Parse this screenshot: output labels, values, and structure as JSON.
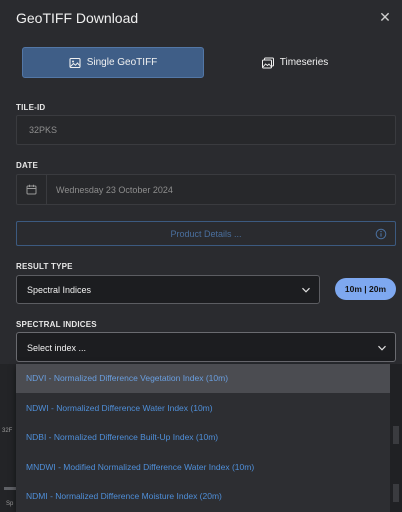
{
  "dialog": {
    "title": "GeoTIFF Download",
    "close_icon": "close-icon"
  },
  "tabs": [
    {
      "label": "Single GeoTIFF",
      "icon": "image-icon",
      "active": true
    },
    {
      "label": "Timeseries",
      "icon": "images-icon",
      "active": false
    }
  ],
  "tile_id": {
    "label": "TILE-ID",
    "value": "32PKS"
  },
  "date": {
    "label": "DATE",
    "icon": "calendar-icon",
    "value": "Wednesday 23 October 2024"
  },
  "product_details": {
    "label": "Product Details ...",
    "icon": "info-icon"
  },
  "result_type": {
    "label": "RESULT TYPE",
    "value": "Spectral Indices",
    "resolution_pill": "10m | 20m"
  },
  "spectral_indices": {
    "label": "SPECTRAL INDICES",
    "placeholder": "Select index ...",
    "options": [
      "NDVI - Normalized Difference Vegetation Index (10m)",
      "NDWI - Normalized Difference Water Index (10m)",
      "NDBI - Normalized Difference Built-Up Index (10m)",
      "MNDWI - Modified Normalized Difference Water Index (10m)",
      "NDMI - Normalized Difference Moisture Index (20m)"
    ],
    "highlighted_index": 0
  },
  "background_fragments": {
    "left_text_1": "32F",
    "left_text_2": "Sp"
  },
  "colors": {
    "panel_bg": "#2a2b2f",
    "tab_active": "#3f5e87",
    "pill": "#7ea8f0",
    "option_text": "#4f8fd9"
  }
}
